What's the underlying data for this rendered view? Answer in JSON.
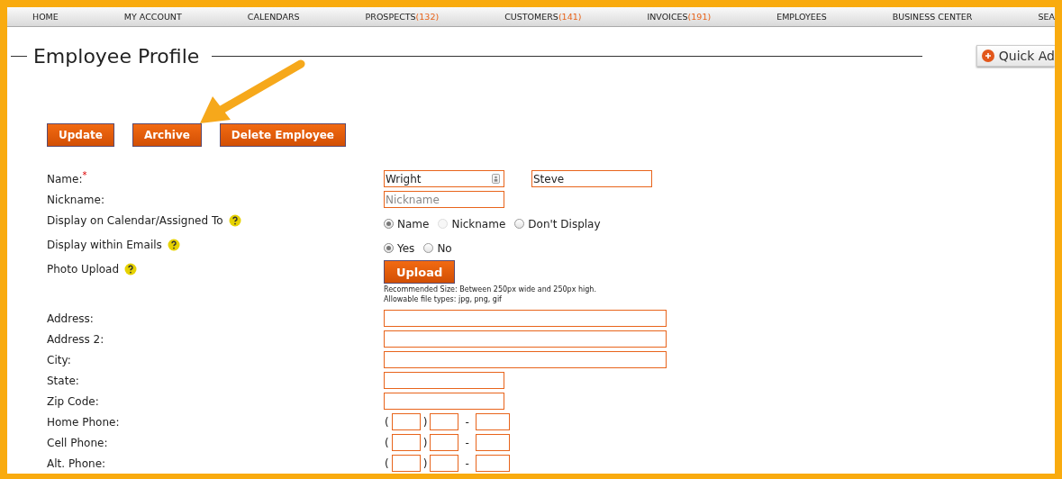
{
  "nav": [
    {
      "label": "HOME"
    },
    {
      "label": "MY ACCOUNT"
    },
    {
      "label": "CALENDARS"
    },
    {
      "label": "PROSPECTS",
      "count": "(132)"
    },
    {
      "label": "CUSTOMERS",
      "count": "(141)"
    },
    {
      "label": "INVOICES",
      "count": "(191)"
    },
    {
      "label": "EMPLOYEES"
    },
    {
      "label": "BUSINESS CENTER"
    },
    {
      "label": "SEA"
    }
  ],
  "page_title": "Employee Profile",
  "quick_add": {
    "label": "Quick Ad"
  },
  "actions": [
    "Update",
    "Archive",
    "Delete Employee"
  ],
  "form": {
    "rows": [
      {
        "kind": "name",
        "label": "Name:",
        "required_mark": "*",
        "fields": [
          {
            "value": "Wright"
          },
          {
            "value": "Steve"
          }
        ]
      },
      {
        "kind": "narrow",
        "label": "Nickname:",
        "placeholder": "Nickname"
      },
      {
        "kind": "radio",
        "label": "Display on Calendar/Assigned To",
        "help": true,
        "options": [
          {
            "label": "Name",
            "selected": true,
            "disabled": false
          },
          {
            "label": "Nickname",
            "selected": false,
            "disabled": true
          },
          {
            "label": "Don't Display",
            "selected": false,
            "disabled": false
          }
        ]
      },
      {
        "kind": "radio",
        "label": "Display within Emails",
        "help": true,
        "options": [
          {
            "label": "Yes",
            "selected": true,
            "disabled": false
          },
          {
            "label": "No",
            "selected": false,
            "disabled": false
          }
        ]
      },
      {
        "kind": "upload",
        "label": "Photo Upload",
        "help": true,
        "button": "Upload",
        "notes": [
          "Recommended Size: Between 250px wide and 250px high.",
          "Allowable file types: jpg, png, gif"
        ]
      },
      {
        "kind": "wide",
        "label": "Address:"
      },
      {
        "kind": "wide",
        "label": "Address 2:"
      },
      {
        "kind": "wide",
        "label": "City:"
      },
      {
        "kind": "narrow",
        "label": "State:"
      },
      {
        "kind": "narrow",
        "label": "Zip Code:"
      },
      {
        "kind": "phone",
        "label": "Home Phone:",
        "parts": [
          "(",
          ")",
          "-"
        ]
      },
      {
        "kind": "phone",
        "label": "Cell Phone:",
        "parts": [
          "(",
          ")",
          "-"
        ]
      },
      {
        "kind": "phone",
        "label": "Alt. Phone:",
        "parts": [
          "(",
          ")",
          "-"
        ]
      }
    ]
  }
}
